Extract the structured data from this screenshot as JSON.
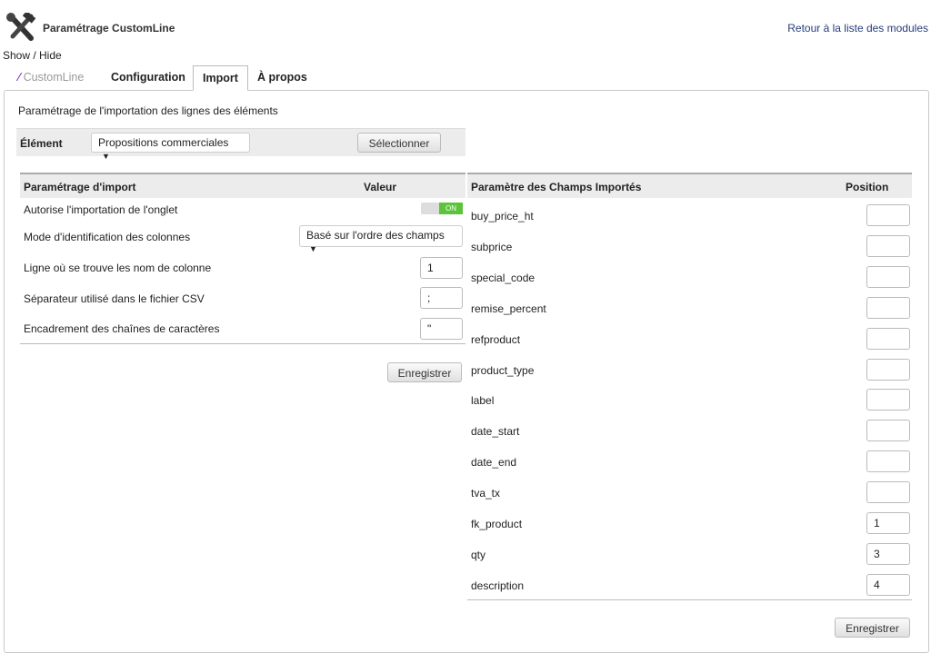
{
  "header": {
    "title": "Paramétrage CustomLine",
    "back_link": "Retour à la liste des modules",
    "show_hide": "Show / Hide"
  },
  "tabs": [
    {
      "label": "CustomLine"
    },
    {
      "label": "Configuration"
    },
    {
      "label": "Import"
    },
    {
      "label": "À propos"
    }
  ],
  "section_title": "Paramétrage de l'importation des lignes des éléments",
  "element": {
    "label": "Élément",
    "selected": "Propositions commerciales",
    "button": "Sélectionner"
  },
  "left_table": {
    "headers": [
      "Paramétrage d'import",
      "Valeur"
    ],
    "rows": [
      {
        "label": "Autorise l'importation de l'onglet",
        "toggle": "ON"
      },
      {
        "label": "Mode d'identification des colonnes",
        "select": "Basé sur l'ordre des champs"
      },
      {
        "label": "Ligne où se trouve les nom de colonne",
        "value": "1"
      },
      {
        "label": "Séparateur utilisé dans le fichier CSV",
        "value": ";"
      },
      {
        "label": "Encadrement des chaînes de caractères",
        "value": "\""
      }
    ],
    "save": "Enregistrer"
  },
  "right_table": {
    "headers": [
      "Paramètre des Champs Importés",
      "Position"
    ],
    "rows": [
      {
        "field": "buy_price_ht",
        "position": ""
      },
      {
        "field": "subprice",
        "position": ""
      },
      {
        "field": "special_code",
        "position": ""
      },
      {
        "field": "remise_percent",
        "position": ""
      },
      {
        "field": "refproduct",
        "position": ""
      },
      {
        "field": "product_type",
        "position": ""
      },
      {
        "field": "label",
        "position": ""
      },
      {
        "field": "date_start",
        "position": ""
      },
      {
        "field": "date_end",
        "position": ""
      },
      {
        "field": "tva_tx",
        "position": ""
      },
      {
        "field": "fk_product",
        "position": "1"
      },
      {
        "field": "qty",
        "position": "3"
      },
      {
        "field": "description",
        "position": "4"
      }
    ],
    "save": "Enregistrer"
  }
}
